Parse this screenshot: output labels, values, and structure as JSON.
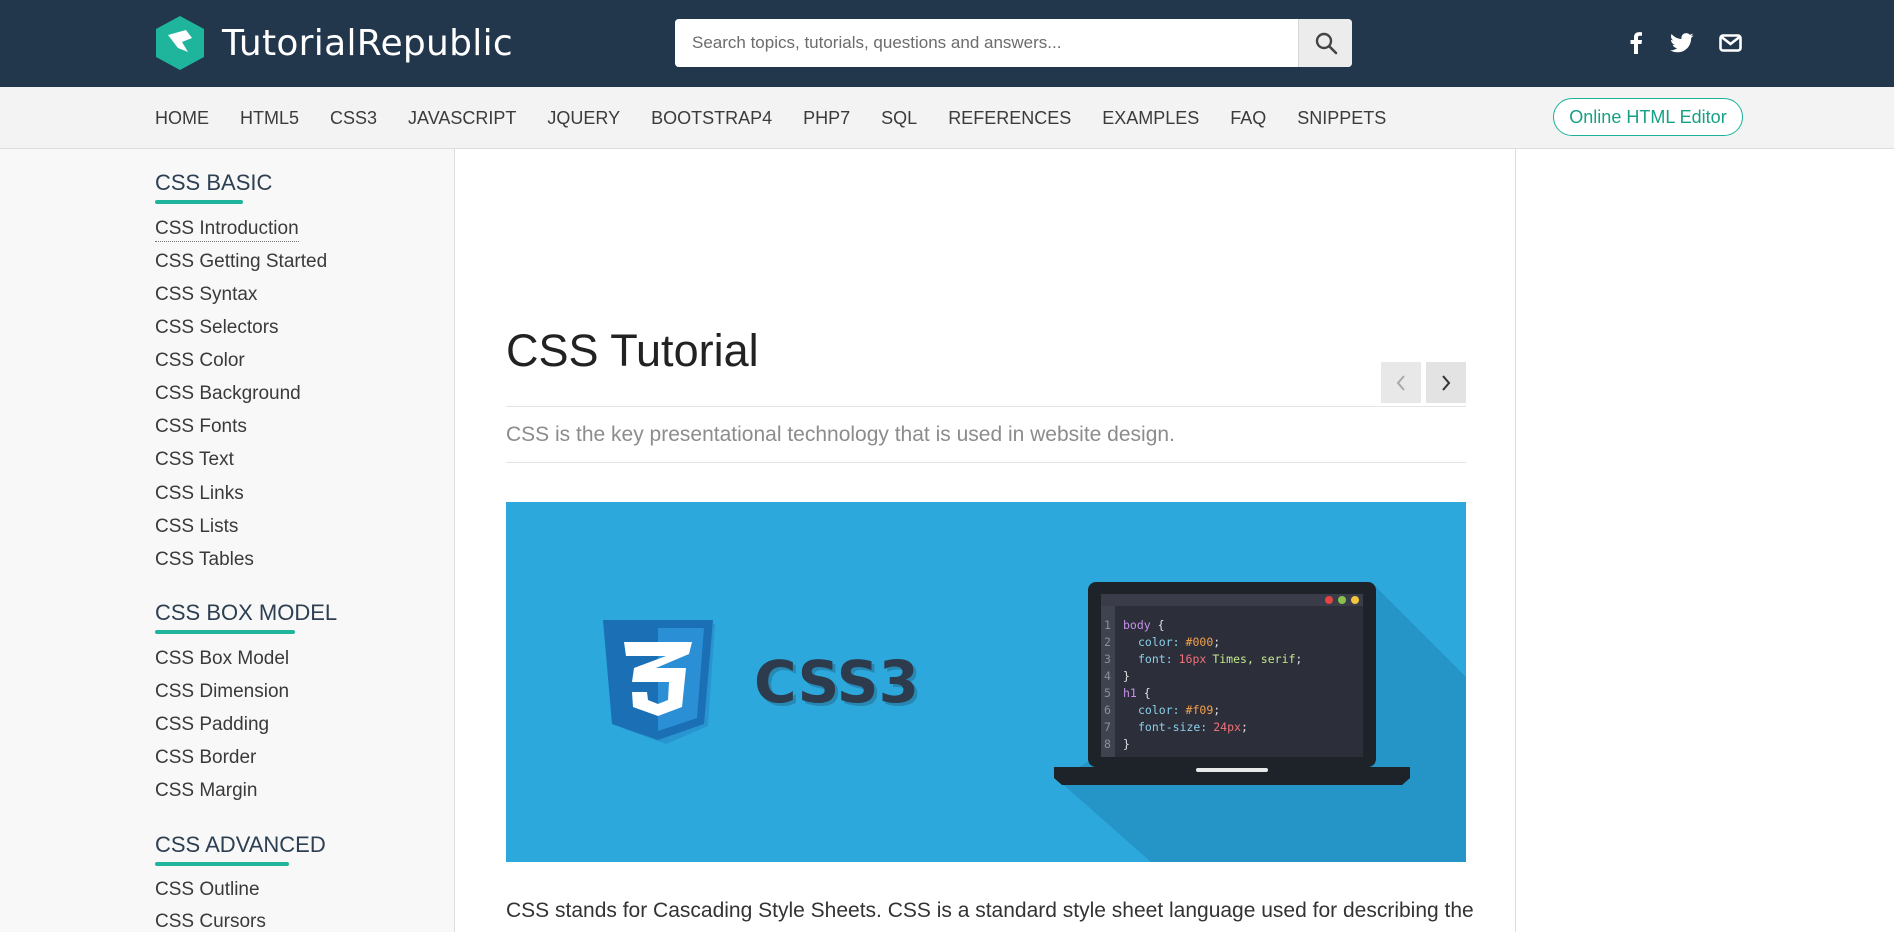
{
  "header": {
    "logo_text": "TutorialRepublic",
    "search_placeholder": "Search topics, tutorials, questions and answers...",
    "social_icons": [
      "facebook-icon",
      "twitter-icon",
      "email-icon"
    ],
    "bg_color": "#22364c"
  },
  "nav": {
    "items": [
      "HOME",
      "HTML5",
      "CSS3",
      "JAVASCRIPT",
      "JQUERY",
      "BOOTSTRAP4",
      "PHP7",
      "SQL",
      "REFERENCES",
      "EXAMPLES",
      "FAQ",
      "SNIPPETS"
    ],
    "editor_button": "Online HTML Editor",
    "accent_color": "#16a085"
  },
  "sidebar": {
    "sections": [
      {
        "title": "CSS BASIC",
        "links": [
          "CSS Introduction",
          "CSS Getting Started",
          "CSS Syntax",
          "CSS Selectors",
          "CSS Color",
          "CSS Background",
          "CSS Fonts",
          "CSS Text",
          "CSS Links",
          "CSS Lists",
          "CSS Tables"
        ]
      },
      {
        "title": "CSS BOX MODEL",
        "links": [
          "CSS Box Model",
          "CSS Dimension",
          "CSS Padding",
          "CSS Border",
          "CSS Margin"
        ]
      },
      {
        "title": "CSS ADVANCED",
        "links": [
          "CSS Outline",
          "CSS Cursors"
        ]
      }
    ]
  },
  "main": {
    "title": "CSS Tutorial",
    "lead": "CSS is the key presentational technology that is used in website design.",
    "intro": "CSS stands for Cascading Style Sheets. CSS is a standard style sheet language used for describing the",
    "banner": {
      "logo_number": "3",
      "logo_label": "CSS3",
      "code_line_numbers": [
        "1",
        "2",
        "3",
        "4",
        "5",
        "6",
        "7",
        "8"
      ],
      "code": {
        "l1_sel": "body",
        "l1_brace": " {",
        "l2_prop": "color:",
        "l2_val": "#000",
        "l2_end": ";",
        "l3_prop": "font:",
        "l3_num": "16px",
        "l3_val": "Times, serif",
        "l3_end": ";",
        "l4": "}",
        "l5_sel": "h1",
        "l5_brace": " {",
        "l6_prop": "color:",
        "l6_val": "#f09",
        "l6_end": ";",
        "l7_prop": "font-size:",
        "l7_num": "24px",
        "l7_end": ";",
        "l8": "}"
      },
      "bg_color": "#2da8dd"
    }
  }
}
